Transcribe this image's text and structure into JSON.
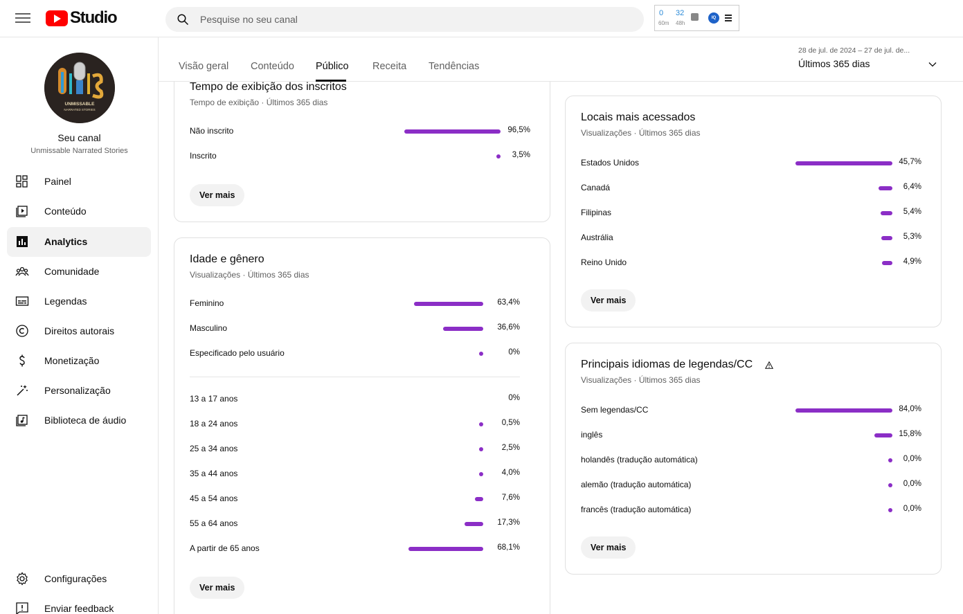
{
  "app": {
    "brand": "Studio"
  },
  "search": {
    "placeholder": "Pesquise no seu canal"
  },
  "extension": {
    "v1": "0",
    "l1": "60m",
    "v2": "32",
    "l2": "48h",
    "badge": "IQ"
  },
  "channel": {
    "label": "Seu canal",
    "name": "Unmissable Narrated Stories",
    "logo_text": "UNMISSABLE NARRATED STORIES"
  },
  "sidebar": {
    "items": [
      {
        "label": "Painel",
        "icon": "dashboard-icon"
      },
      {
        "label": "Conteúdo",
        "icon": "content-icon"
      },
      {
        "label": "Analytics",
        "icon": "analytics-icon"
      },
      {
        "label": "Comunidade",
        "icon": "community-icon"
      },
      {
        "label": "Legendas",
        "icon": "subtitles-icon"
      },
      {
        "label": "Direitos autorais",
        "icon": "copyright-icon"
      },
      {
        "label": "Monetização",
        "icon": "dollar-icon"
      },
      {
        "label": "Personalização",
        "icon": "magic-wand-icon"
      },
      {
        "label": "Biblioteca de áudio",
        "icon": "audio-library-icon"
      }
    ],
    "bottom": [
      {
        "label": "Configurações",
        "icon": "gear-icon"
      },
      {
        "label": "Enviar feedback",
        "icon": "feedback-icon"
      }
    ]
  },
  "tabs": [
    "Visão geral",
    "Conteúdo",
    "Público",
    "Receita",
    "Tendências"
  ],
  "daterange": {
    "range": "28 de jul. de 2024 – 27 de jul. de...",
    "label": "Últimos 365 dias"
  },
  "accent": "#8b2ec6",
  "cards": {
    "subscribers": {
      "title": "Tempo de exibição dos inscritos",
      "sub": "Tempo de exibição · Últimos 365 dias",
      "rows": [
        {
          "label": "Não inscrito",
          "pct": "96,5%",
          "value": 96.5
        },
        {
          "label": "Inscrito",
          "pct": "3,5%",
          "value": 3.5
        }
      ],
      "more": "Ver mais"
    },
    "age_gender": {
      "title": "Idade e gênero",
      "sub": "Visualizações · Últimos 365 dias",
      "gender": [
        {
          "label": "Feminino",
          "pct": "63,4%",
          "value": 63.4
        },
        {
          "label": "Masculino",
          "pct": "36,6%",
          "value": 36.6
        },
        {
          "label": "Especificado pelo usuário",
          "pct": "0%",
          "value": 0.01
        }
      ],
      "age": [
        {
          "label": "13 a 17 anos",
          "pct": "0%",
          "value": 0
        },
        {
          "label": "18 a 24 anos",
          "pct": "0,5%",
          "value": 0.5
        },
        {
          "label": "25 a 34 anos",
          "pct": "2,5%",
          "value": 2.5
        },
        {
          "label": "35 a 44 anos",
          "pct": "4,0%",
          "value": 4.0
        },
        {
          "label": "45 a 54 anos",
          "pct": "7,6%",
          "value": 7.6
        },
        {
          "label": "55 a 64 anos",
          "pct": "17,3%",
          "value": 17.3
        },
        {
          "label": "A partir de 65 anos",
          "pct": "68,1%",
          "value": 68.1
        }
      ],
      "more": "Ver mais"
    },
    "locations": {
      "title": "Locais mais acessados",
      "sub": "Visualizações · Últimos 365 dias",
      "rows": [
        {
          "label": "Estados Unidos",
          "pct": "45,7%",
          "value": 45.7
        },
        {
          "label": "Canadá",
          "pct": "6,4%",
          "value": 6.4
        },
        {
          "label": "Filipinas",
          "pct": "5,4%",
          "value": 5.4
        },
        {
          "label": "Austrália",
          "pct": "5,3%",
          "value": 5.3
        },
        {
          "label": "Reino Unido",
          "pct": "4,9%",
          "value": 4.9
        }
      ],
      "more": "Ver mais"
    },
    "languages": {
      "title": "Principais idiomas de legendas/CC",
      "sub": "Visualizações · Últimos 365 dias",
      "rows": [
        {
          "label": "Sem legendas/CC",
          "pct": "84,0%",
          "value": 84.0
        },
        {
          "label": "inglês",
          "pct": "15,8%",
          "value": 15.8
        },
        {
          "label": "holandês (tradução automática)",
          "pct": "0,0%",
          "value": 0.01
        },
        {
          "label": "alemão (tradução automática)",
          "pct": "0,0%",
          "value": 0.01
        },
        {
          "label": "francês (tradução automática)",
          "pct": "0,0%",
          "value": 0.01
        }
      ],
      "more": "Ver mais"
    }
  }
}
